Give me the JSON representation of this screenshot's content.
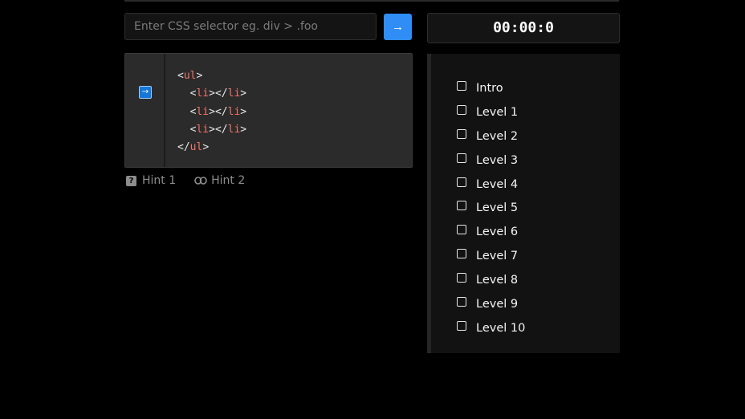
{
  "selector": {
    "placeholder": "Enter CSS selector eg. div > .foo",
    "value": "",
    "submit_icon": "arrow-right-icon",
    "submit_symbol": "→"
  },
  "timer": {
    "display": "00:00:0"
  },
  "code": {
    "marker_symbol": "→",
    "lines": [
      {
        "indent": "",
        "open": "<",
        "name": "ul",
        "close": ">",
        "open2": "",
        "name2": "",
        "close2": ""
      },
      {
        "indent": "  ",
        "open": "<",
        "name": "li",
        "close": ">",
        "open2": "</",
        "name2": "li",
        "close2": ">"
      },
      {
        "indent": "  ",
        "open": "<",
        "name": "li",
        "close": ">",
        "open2": "</",
        "name2": "li",
        "close2": ">"
      },
      {
        "indent": "  ",
        "open": "<",
        "name": "li",
        "close": ">",
        "open2": "</",
        "name2": "li",
        "close2": ">"
      },
      {
        "indent": "",
        "open": "</",
        "name": "ul",
        "close": ">",
        "open2": "",
        "name2": "",
        "close2": ""
      }
    ]
  },
  "hints": {
    "hint1_label": "Hint 1",
    "hint1_icon_glyph": "?",
    "hint2_label": "Hint 2"
  },
  "levels": {
    "items": [
      {
        "label": "Intro",
        "checked": false
      },
      {
        "label": "Level 1",
        "checked": false
      },
      {
        "label": "Level 2",
        "checked": false
      },
      {
        "label": "Level 3",
        "checked": false
      },
      {
        "label": "Level 4",
        "checked": false
      },
      {
        "label": "Level 5",
        "checked": false
      },
      {
        "label": "Level 6",
        "checked": false
      },
      {
        "label": "Level 7",
        "checked": false
      },
      {
        "label": "Level 8",
        "checked": false
      },
      {
        "label": "Level 9",
        "checked": false
      },
      {
        "label": "Level 10",
        "checked": false
      }
    ]
  },
  "colors": {
    "accent": "#2f8df5",
    "tag": "#f2736a",
    "background": "#000000"
  }
}
